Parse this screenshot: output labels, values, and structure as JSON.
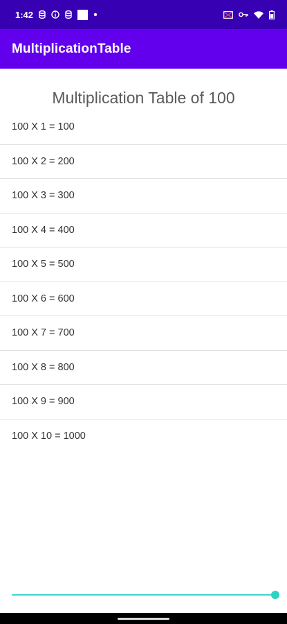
{
  "status_bar": {
    "time": "1:42",
    "left_icons": [
      "database-icon",
      "info-circle-icon",
      "database-icon",
      "square-icon",
      "dot-icon"
    ],
    "right_icons": [
      "cast-icon",
      "vpn-key-icon",
      "wifi-icon",
      "battery-icon"
    ]
  },
  "app_bar": {
    "title": "MultiplicationTable",
    "color": "#6200ee",
    "status_color": "#3700b3"
  },
  "main": {
    "heading": "Multiplication Table of 100",
    "rows": [
      "100 X 1 = 100",
      "100 X 2 = 200",
      "100 X 3 = 300",
      "100 X 4 = 400",
      "100 X 5 = 500",
      "100 X 6 = 600",
      "100 X 7 = 700",
      "100 X 8 = 800",
      "100 X 9 = 900",
      "100 X 10 = 1000"
    ]
  },
  "slider": {
    "value": 1.0,
    "accent": "#40d6c8"
  }
}
